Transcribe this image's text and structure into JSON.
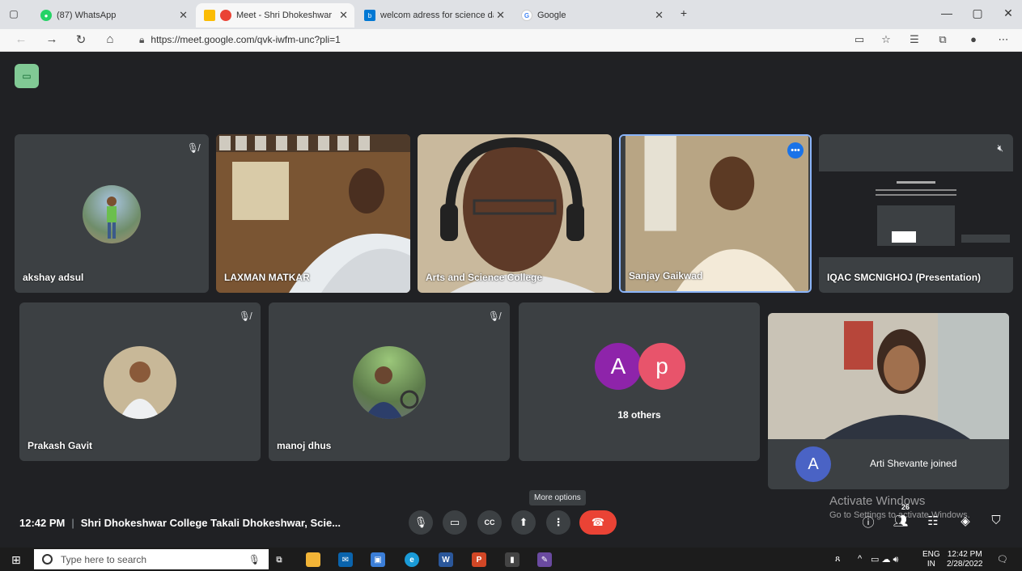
{
  "browser": {
    "tabs": [
      {
        "title": "(87) WhatsApp"
      },
      {
        "title": "Meet - Shri Dhokeshwar Co"
      },
      {
        "title": "welcom adress for science day fu"
      },
      {
        "title": "Google"
      }
    ],
    "url": "https://meet.google.com/qvk-iwfm-unc?pli=1"
  },
  "participants": {
    "akshay": "akshay adsul",
    "laxman": "LAXMAN MATKAR",
    "arts": "Arts and Science College",
    "sanjay": "Sanjay Gaikwad",
    "iqac": "IQAC SMCNIGHOJ (Presentation)",
    "prakash": "Prakash Gavit",
    "manoj": "manoj dhus",
    "others": "18 others",
    "others_letter1": "A",
    "others_letter2": "p",
    "arti_letter": "A",
    "arti_joined": "Arti Shevante joined"
  },
  "meeting": {
    "time": "12:42 PM",
    "title": "Shri Dhokeshwar College Takali Dhokeshwar, Scie...",
    "tooltip": "More options",
    "participants_count": "26"
  },
  "watermark": {
    "line1": "Activate Windows",
    "line2": "Go to Settings to activate Windows."
  },
  "taskbar": {
    "search_placeholder": "Type here to search",
    "lang1": "ENG",
    "lang2": "IN",
    "time": "12:42 PM",
    "date": "2/28/2022"
  },
  "colors": {
    "meet_bg": "#202124",
    "tile_bg": "#3c4043",
    "end_call": "#ea4335",
    "active_speaker_border": "#8ab4f8",
    "avatar_purple": "#8e24aa",
    "avatar_pink": "#e8546b",
    "avatar_blue": "#4a63c5"
  }
}
